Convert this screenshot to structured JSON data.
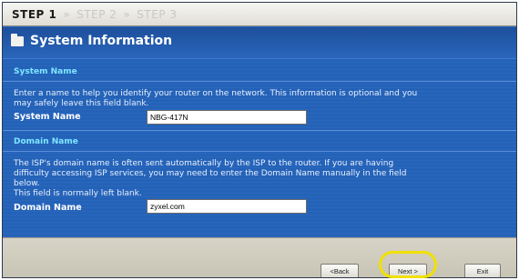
{
  "steps": [
    "STEP 1",
    "STEP 2",
    "STEP 3"
  ],
  "step_separator": "»",
  "page": {
    "title": "System Information",
    "title_icon": "folder-icon"
  },
  "system_name_section": {
    "heading": "System Name",
    "description": "Enter a name to help you identify your router on the network. This information is optional and you\nmay safely leave this field blank.",
    "field_label": "System Name",
    "field_value": "NBG-417N"
  },
  "domain_name_section": {
    "heading": "Domain Name",
    "description": "The ISP's domain name is often sent automatically by the ISP to the router. If you are having\ndifficulty accessing ISP services, you may need to enter the Domain Name manually in the field\nbelow.\nThis field is normally left blank.",
    "field_label": "Domain Name",
    "field_value": "zyxel.com"
  },
  "footer": {
    "back_label": "<Back",
    "next_label": "Next >",
    "exit_label": "Exit"
  },
  "colors": {
    "accent_heading": "#7fe6ff",
    "panel_blue": "#2462b8",
    "highlight": "#f2e000"
  }
}
